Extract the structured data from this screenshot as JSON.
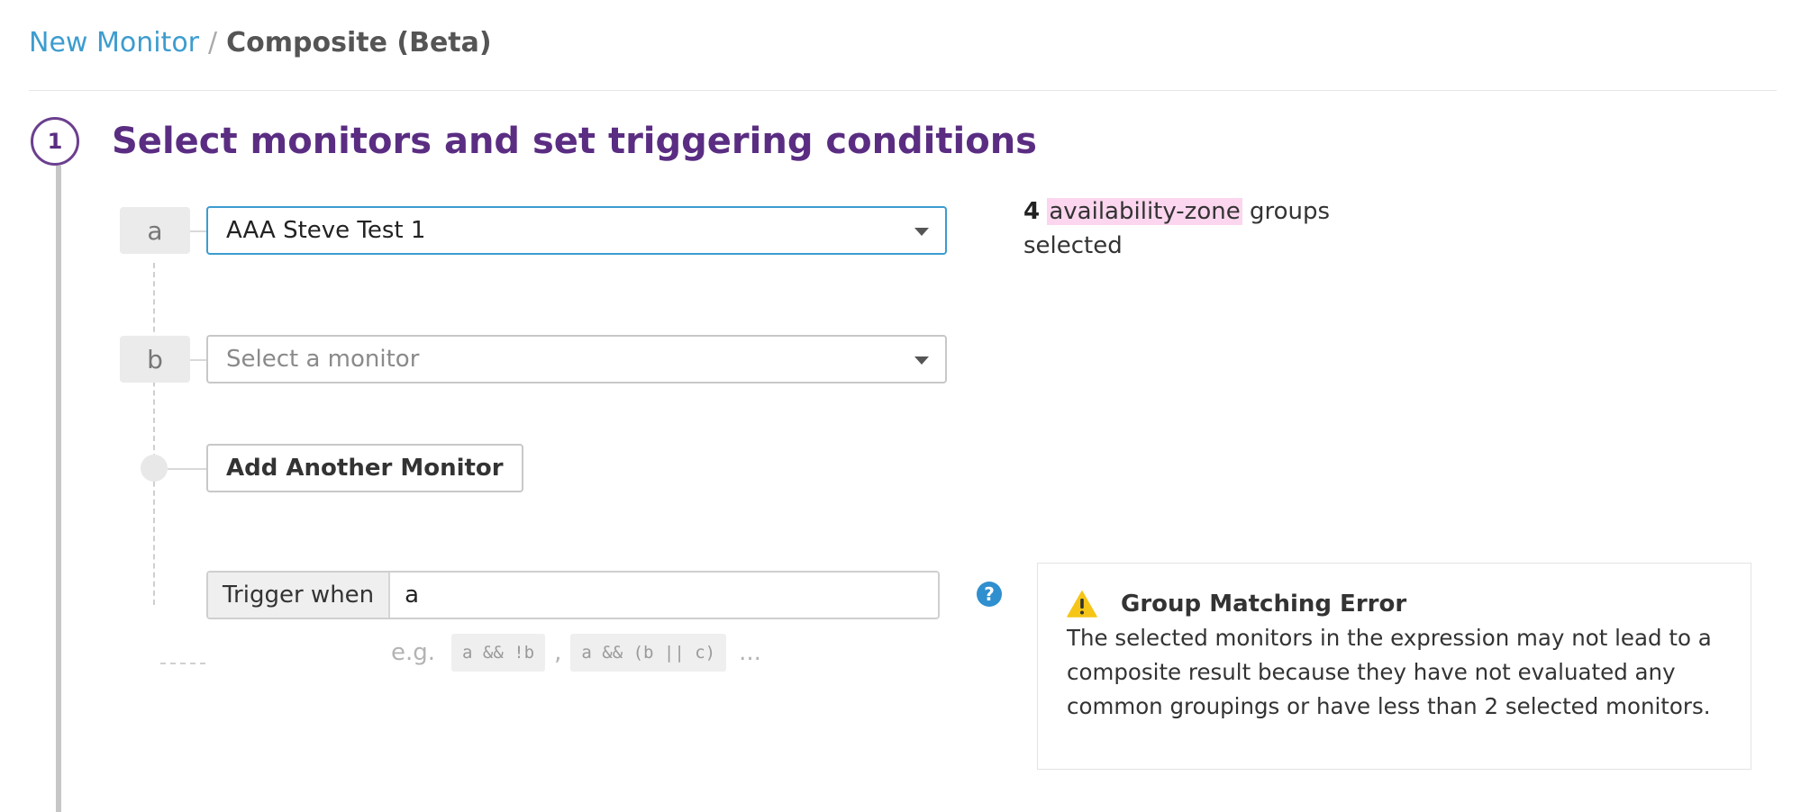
{
  "breadcrumb": {
    "parent": "New Monitor",
    "separator": "/",
    "current": "Composite (Beta)"
  },
  "step": {
    "number": "1",
    "title": "Select monitors and set triggering conditions"
  },
  "monitors": [
    {
      "letter": "a",
      "value": "AAA Steve Test 1",
      "placeholder": ""
    },
    {
      "letter": "b",
      "value": "",
      "placeholder": "Select a monitor"
    }
  ],
  "groups_info": {
    "count": "4",
    "tag": "availability-zone",
    "suffix": "groups selected"
  },
  "add_button": {
    "label": "Add Another Monitor"
  },
  "trigger": {
    "label": "Trigger when",
    "value": "a",
    "help_icon": "question-icon"
  },
  "examples": {
    "prefix": "e.g.",
    "items": [
      "a && !b",
      "a && (b || c)"
    ],
    "separator": ",",
    "ellipsis": "..."
  },
  "error": {
    "icon": "warning-icon",
    "title": "Group Matching Error",
    "message": "The selected monitors in the expression may not lead to a composite result because they have not evaluated any common groupings or have less than 2 selected monitors."
  },
  "colors": {
    "accent_purple": "#5a2d82",
    "link_blue": "#3d9ccf",
    "highlight_pink": "#fbd6ee",
    "warning_yellow": "#f5c518"
  }
}
